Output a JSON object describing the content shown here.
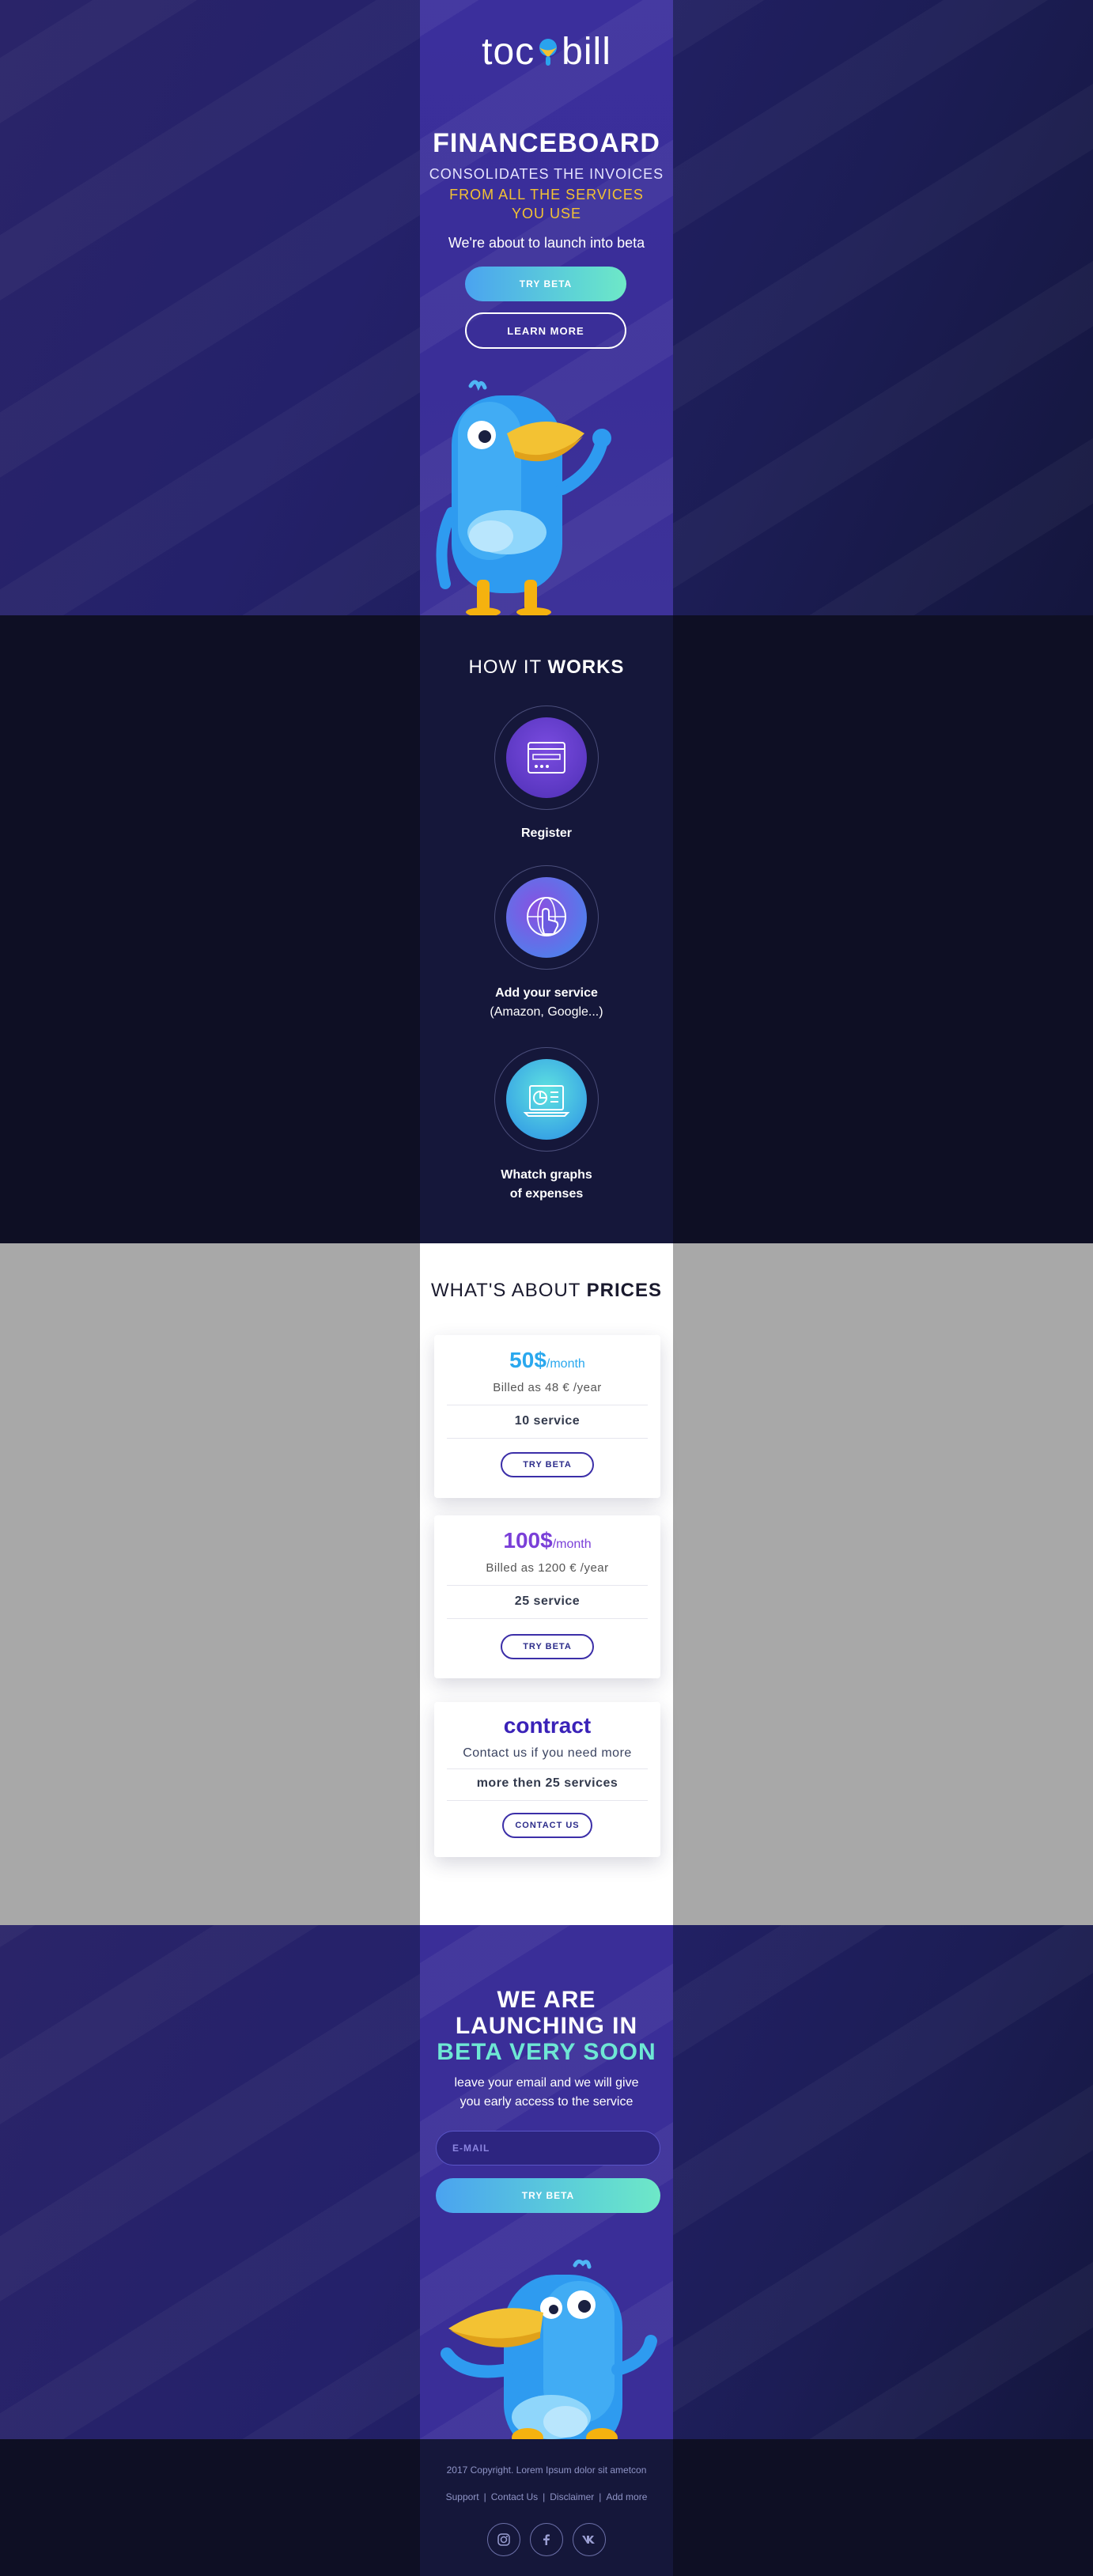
{
  "brand": {
    "logo_left": "toc",
    "logo_right": "bill"
  },
  "hero": {
    "title": "FINANCEBOARD",
    "subtitle_line1": "CONSOLIDATES THE INVOICES",
    "subtitle_highlight": "FROM ALL THE SERVICES YOU USE",
    "beta_note": "We're about to launch into beta",
    "try_beta_label": "TRY BETA",
    "learn_more_label": "LEARN MORE"
  },
  "how": {
    "title_light": "HOW IT",
    "title_bold": "WORKS",
    "steps": [
      {
        "label": "Register",
        "sublabel": "",
        "icon": "browser-window-icon"
      },
      {
        "label": "Add your service",
        "sublabel": "(Amazon, Google...)",
        "icon": "touch-globe-icon"
      },
      {
        "label": "Whatch graphs",
        "sublabel": "of expenses",
        "icon": "laptop-chart-icon"
      }
    ]
  },
  "prices": {
    "title_light": "WHAT'S ABOUT",
    "title_bold": "PRICES",
    "plans": [
      {
        "price": "50$",
        "unit": "/month",
        "billed": "Billed as 48 € /year",
        "services": "10 service",
        "button": "TRY BETA",
        "color": "#2aa8ee"
      },
      {
        "price": "100$",
        "unit": "/month",
        "billed": "Billed as 1200 € /year",
        "services": "25 service",
        "button": "TRY BETA",
        "color": "#7a3fd8"
      },
      {
        "price": "contract",
        "unit": "",
        "billed": "Contact us if you need more",
        "services": "more then 25 services",
        "button": "CONTACT US",
        "color": "#3a22b8"
      }
    ]
  },
  "launch": {
    "title_line1": "WE ARE",
    "title_line2": "LAUNCHING IN",
    "title_line3": "BETA VERY SOON",
    "sub_line1": "leave your email and we will give",
    "sub_line2": "you early access to the service",
    "email_placeholder": "E-MAIL",
    "button": "TRY BETA"
  },
  "footer": {
    "copyright": "2017 Copyright. Lorem Ipsum dolor sit ametcon",
    "links": [
      "Support",
      "Contact Us",
      "Disclaimer",
      "Add more"
    ],
    "social": [
      "instagram-icon",
      "facebook-icon",
      "vk-icon"
    ]
  },
  "colors": {
    "accent_yellow": "#f3c233",
    "accent_teal": "#6ee7d4",
    "brand_purple": "#3a2e98"
  }
}
